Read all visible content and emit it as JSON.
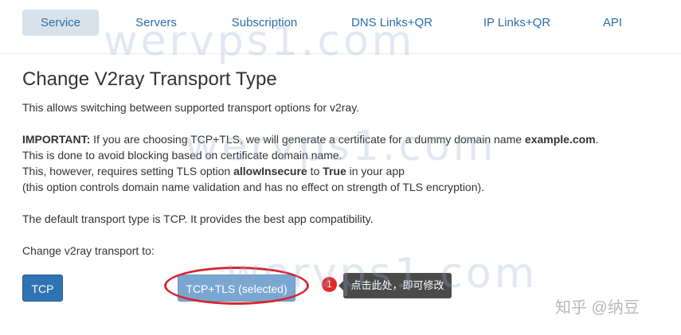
{
  "tabs": [
    {
      "label": "Service",
      "active": true
    },
    {
      "label": "Servers"
    },
    {
      "label": "Subscription"
    },
    {
      "label": "DNS Links+QR"
    },
    {
      "label": "IP Links+QR"
    },
    {
      "label": "API"
    }
  ],
  "watermark": "wervps1.com",
  "heading": "Change V2ray Transport Type",
  "content": {
    "intro": "This allows switching between supported transport options for v2ray.",
    "important": {
      "label": "IMPORTANT:",
      "text_a": " If you are choosing TCP+TLS, we will generate a certificate for a dummy domain name ",
      "domain": "example.com",
      "text_b": "."
    },
    "line_blocking": "This is done to avoid blocking based on certificate domain name.",
    "tls_option": {
      "text_a": "This, however, requires setting TLS option ",
      "option": "allowInsecure",
      "text_b": " to ",
      "value": "True",
      "text_c": " in your app"
    },
    "line_validation": "(this option controls domain name validation and has no effect on strength of TLS encryption).",
    "default_note": "The default transport type is TCP. It provides the best app compatibility.",
    "change_label": "Change v2ray transport to:"
  },
  "buttons": {
    "tcp": "TCP",
    "tcp_tls": "TCP+TLS (selected)"
  },
  "annotation": {
    "badge": "1",
    "tooltip": "点击此处，即可修改"
  },
  "credit": "知乎 @纳豆",
  "colors": {
    "accent": "#2f73b5",
    "selected_button": "#7aa6d2",
    "active_tab_bg": "#d8e2eb",
    "annotation_red": "#d6262e",
    "tooltip_bg": "#4a4a4a"
  }
}
